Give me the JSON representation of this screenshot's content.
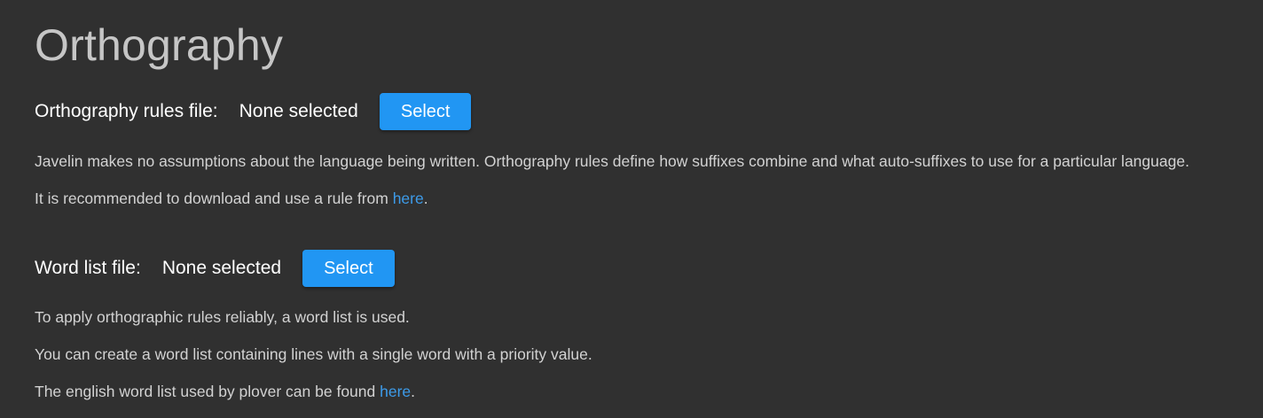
{
  "page": {
    "title": "Orthography"
  },
  "orthography": {
    "label": "Orthography rules file:",
    "value": "None selected",
    "select_label": "Select",
    "description": "Javelin makes no assumptions about the language being written. Orthography rules define how suffixes combine and what auto-suffixes to use for a particular language.",
    "recommend_prefix": "It is recommended to download and use a rule from ",
    "recommend_link": "here",
    "recommend_suffix": "."
  },
  "word_list": {
    "label": "Word list file:",
    "value": "None selected",
    "select_label": "Select",
    "line1": "To apply orthographic rules reliably, a word list is used.",
    "line2": "You can create a word list containing lines with a single word with a priority value.",
    "line3_prefix": "The english word list used by plover can be found ",
    "line3_link": "here",
    "line3_suffix": "."
  },
  "colors": {
    "background": "#303030",
    "accent": "#2196f3",
    "link": "#3d9be9"
  }
}
